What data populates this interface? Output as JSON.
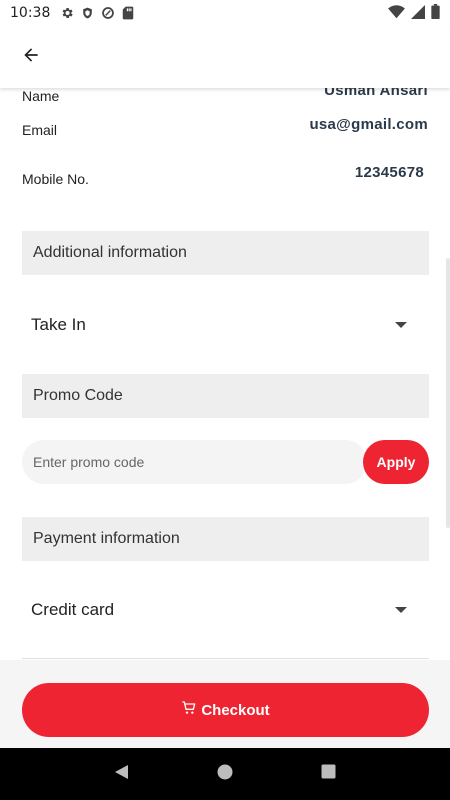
{
  "status_bar": {
    "time": "10:38",
    "left_icons": [
      "settings-gear-icon",
      "shield-icon",
      "data-saver-icon",
      "sd-card-icon"
    ],
    "right_icons": [
      "wifi-icon",
      "signal-icon",
      "battery-icon"
    ]
  },
  "app_bar": {
    "back_icon": "arrow-back-icon"
  },
  "customer": {
    "name_label": "Name",
    "name_value": "Usman Ansari",
    "email_label": "Email",
    "email_value": "usa@gmail.com",
    "mobile_label": "Mobile No.",
    "mobile_value": "12345678"
  },
  "additional": {
    "header": "Additional information",
    "order_type": "Take In"
  },
  "promo": {
    "header": "Promo Code",
    "placeholder": "Enter promo code",
    "value": "",
    "apply_label": "Apply"
  },
  "payment": {
    "header": "Payment information",
    "method": "Credit card"
  },
  "checkout": {
    "label": "Checkout",
    "icon": "cart-icon"
  },
  "nav_bar": {
    "buttons": [
      "back-triangle-icon",
      "home-circle-icon",
      "recents-square-icon"
    ]
  },
  "colors": {
    "accent": "#ee2432",
    "section_bg": "#eeeeee",
    "value_text": "#2b3a4a"
  }
}
